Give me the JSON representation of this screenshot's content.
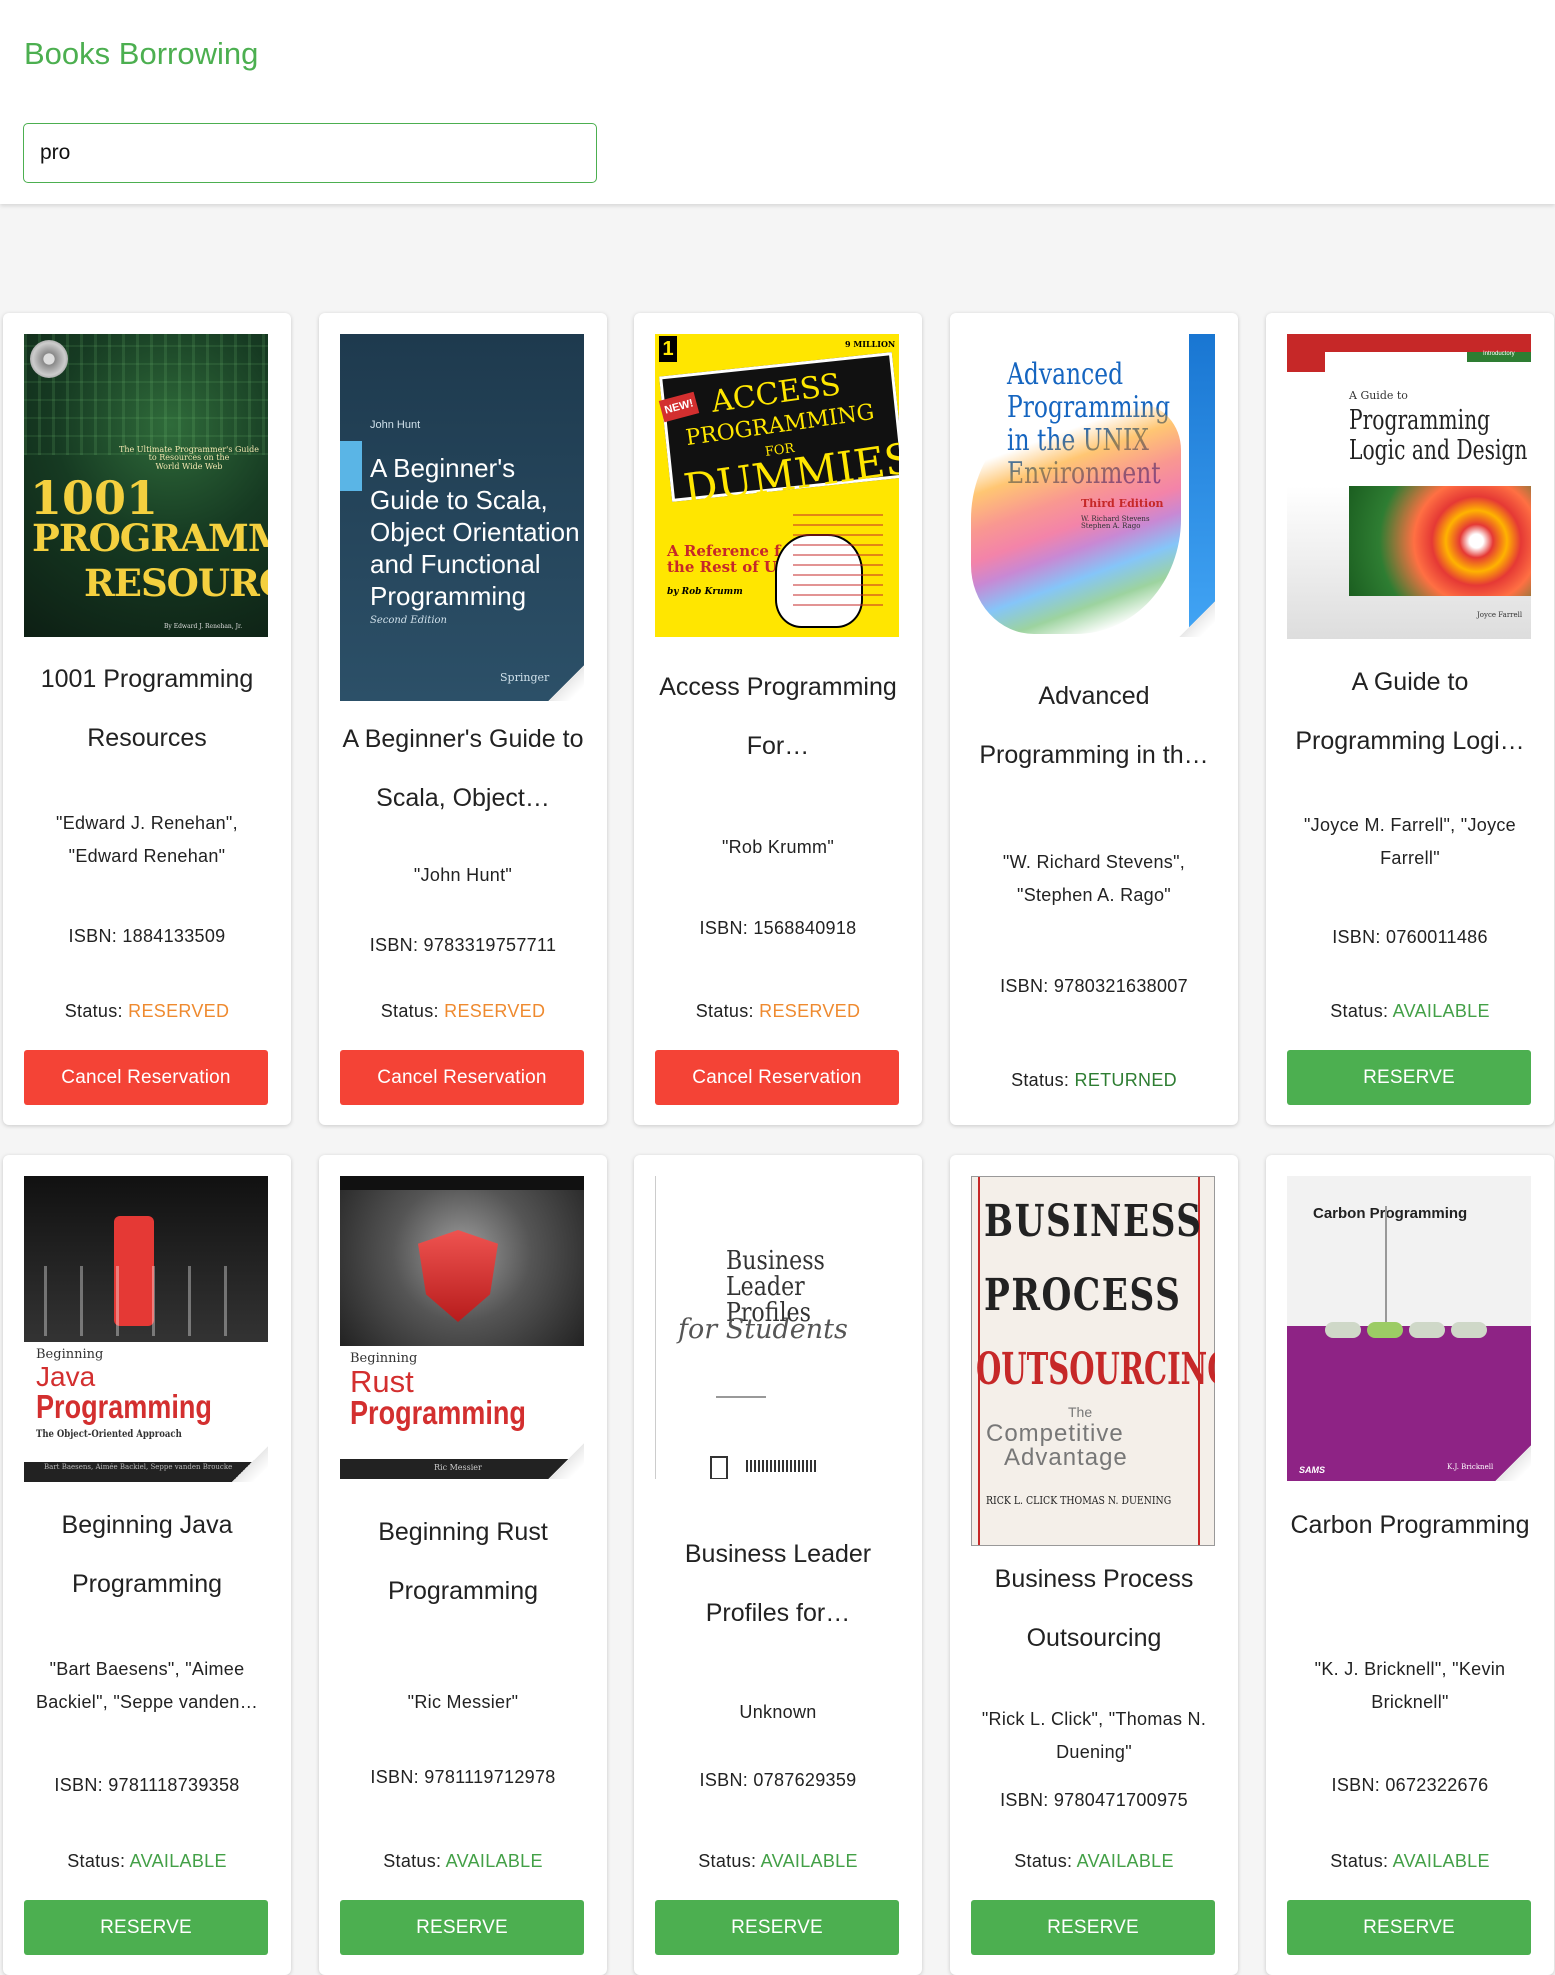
{
  "header": {
    "title": "Books Borrowing",
    "search_value": "pro"
  },
  "colors": {
    "accent": "#4caf50",
    "reserved": "#ef8a2f",
    "available": "#43a047",
    "returned": "#2e7d32",
    "cancel": "#f44336"
  },
  "labels": {
    "status_prefix": "Status: ",
    "isbn_prefix": "ISBN: "
  },
  "books": [
    {
      "title": "1001 Programming Resources",
      "authors": "\"Edward J. Renehan\", \"Edward Renehan\"",
      "isbn": "ISBN: 1884133509",
      "status": "RESERVED",
      "action": "Cancel Reservation",
      "cover": {
        "lines": [
          "The Ultimate Programmer's Guide",
          "to Resources on the",
          "World Wide Web",
          "1001",
          "PROGRAMMING",
          "RESOURCES",
          "By Edward J. Renehan, Jr."
        ]
      }
    },
    {
      "title": "A Beginner's Guide to Scala, Object…",
      "authors": "\"John Hunt\"",
      "isbn": "ISBN: 9783319757711",
      "status": "RESERVED",
      "action": "Cancel Reservation",
      "cover": {
        "lines": [
          "John Hunt",
          "A Beginner's",
          "Guide to Scala,",
          "Object Orientation",
          "and Functional",
          "Programming",
          "Second Edition",
          "Springer"
        ]
      }
    },
    {
      "title": "Access Programming For…",
      "authors": "\"Rob Krumm\"",
      "isbn": "ISBN: 1568840918",
      "status": "RESERVED",
      "action": "Cancel Reservation",
      "cover": {
        "lines": [
          "ACCESS",
          "PROGRAMMING",
          "FOR",
          "DUMMIES",
          "A Reference for",
          "the Rest of Us!",
          "by Rob Krumm",
          "NEW!",
          "9 MILLION"
        ]
      }
    },
    {
      "title": "Advanced Programming in th…",
      "authors": "\"W. Richard Stevens\", \"Stephen A. Rago\"",
      "isbn": "ISBN: 9780321638007",
      "status": "RETURNED",
      "action": "",
      "cover": {
        "lines": [
          "Advanced",
          "Programming",
          "in the UNIX",
          "Environment",
          "Third Edition",
          "W. Richard Stevens",
          "Stephen A. Rago"
        ]
      }
    },
    {
      "title": "A Guide to Programming Logi…",
      "authors": "\"Joyce M. Farrell\", \"Joyce Farrell\"",
      "isbn": "ISBN: 0760011486",
      "status": "AVAILABLE",
      "action": "RESERVE",
      "cover": {
        "lines": [
          "A Guide to",
          "Programming",
          "Logic and Design",
          "Joyce Farrell",
          "Introductory"
        ]
      }
    },
    {
      "title": "Beginning Java Programming",
      "authors": "\"Bart Baesens\", \"Aimee Backiel\", \"Seppe vanden…",
      "isbn": "ISBN: 9781118739358",
      "status": "AVAILABLE",
      "action": "RESERVE",
      "cover": {
        "lines": [
          "Beginning",
          "Java",
          "Programming",
          "The Object-Oriented Approach",
          "Bart Baesens, Aimée Backiel, Seppe vanden Broucke"
        ]
      }
    },
    {
      "title": "Beginning Rust Programming",
      "authors": "\"Ric Messier\"",
      "isbn": "ISBN: 9781119712978",
      "status": "AVAILABLE",
      "action": "RESERVE",
      "cover": {
        "lines": [
          "Beginning",
          "Rust",
          "Programming",
          "Ric Messier"
        ]
      }
    },
    {
      "title": "Business Leader Profiles for…",
      "authors": "Unknown",
      "isbn": "ISBN: 0787629359",
      "status": "AVAILABLE",
      "action": "RESERVE",
      "cover": {
        "lines": [
          "Business",
          "Leader",
          "Profiles",
          "for Students"
        ]
      }
    },
    {
      "title": "Business Process Outsourcing",
      "authors": "\"Rick L. Click\", \"Thomas N. Duening\"",
      "isbn": "ISBN: 9780471700975",
      "status": "AVAILABLE",
      "action": "RESERVE",
      "cover": {
        "lines": [
          "BUSINESS",
          "PROCESS",
          "OUTSOURCING",
          "The",
          "Competitive",
          "Advantage",
          "RICK L. CLICK   THOMAS N. DUENING"
        ]
      }
    },
    {
      "title": "Carbon Programming",
      "authors": "\"K. J. Bricknell\", \"Kevin Bricknell\"",
      "isbn": "ISBN: 0672322676",
      "status": "AVAILABLE",
      "action": "RESERVE",
      "cover": {
        "lines": [
          "Carbon Programming",
          "SAMS",
          "K.J. Bricknell"
        ]
      }
    }
  ]
}
